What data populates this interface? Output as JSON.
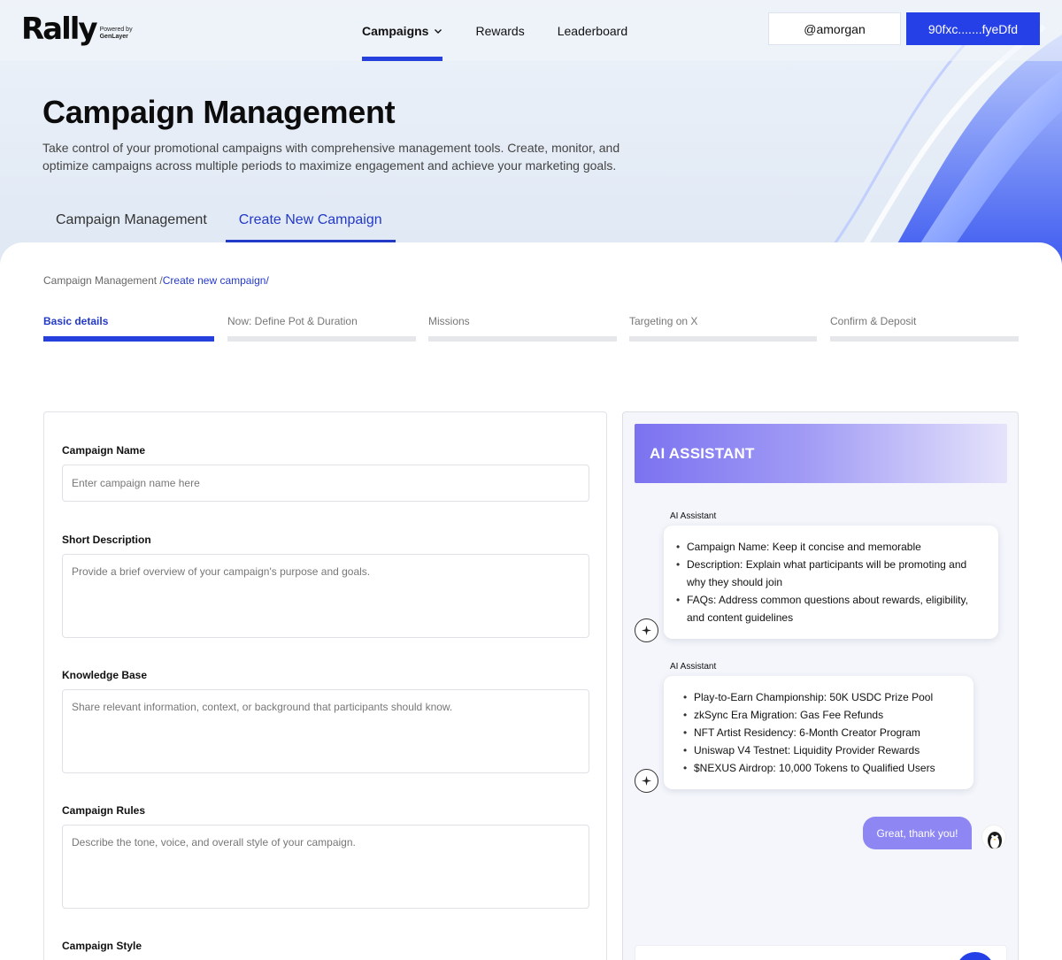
{
  "brand": {
    "logo_text": "Rally",
    "powered_by": "Powered by",
    "powered_name": "GenLayer"
  },
  "nav": {
    "links": [
      {
        "label": "Campaigns",
        "active": true
      },
      {
        "label": "Rewards",
        "active": false
      },
      {
        "label": "Leaderboard",
        "active": false
      }
    ],
    "user_handle": "@amorgan",
    "wallet": "90fxc.......fyeDfd"
  },
  "hero": {
    "title": "Campaign Management",
    "description": "Take control of your promotional campaigns with comprehensive management tools. Create, monitor, and optimize campaigns across multiple periods to maximize engagement and achieve your marketing goals.",
    "tabs": [
      {
        "label": "Campaign Management",
        "active": false
      },
      {
        "label": "Create New Campaign",
        "active": true
      }
    ]
  },
  "breadcrumb": {
    "root": "Campaign Management /",
    "current": "Create new campaign/"
  },
  "steps": [
    {
      "label": "Basic details",
      "active": true
    },
    {
      "label": "Now: Define Pot & Duration",
      "active": false
    },
    {
      "label": "Missions",
      "active": false
    },
    {
      "label": "Targeting on X",
      "active": false
    },
    {
      "label": "Confirm & Deposit",
      "active": false
    }
  ],
  "form": {
    "name": {
      "label": "Campaign Name",
      "placeholder": "Enter campaign name here",
      "value": ""
    },
    "description": {
      "label": "Short Description",
      "placeholder": "Provide a brief overview of your campaign's purpose and goals.",
      "value": ""
    },
    "knowledge": {
      "label": "Knowledge Base",
      "placeholder": "Share relevant information, context, or background that participants should know.",
      "value": ""
    },
    "rules": {
      "label": "Campaign Rules",
      "placeholder": "Describe the tone, voice, and overall style of your campaign.",
      "value": ""
    },
    "style": {
      "label": "Campaign Style"
    }
  },
  "assistant": {
    "title": "AI ASSISTANT",
    "messages": [
      {
        "sender": "AI Assistant",
        "items": [
          "Campaign Name: Keep it concise and memorable",
          "Description: Explain what participants will be promoting and why they should join",
          "FAQs: Address common questions about rewards, eligibility, and content guidelines"
        ]
      },
      {
        "sender": "AI Assistant",
        "items": [
          "Play-to-Earn Championship: 50K USDC Prize Pool",
          "zkSync Era Migration: Gas Fee Refunds",
          "NFT Artist Residency: 6-Month Creator Program",
          "Uniswap V4 Testnet: Liquidity Provider Rewards",
          "$NEXUS Airdrop: 10,000 Tokens to Qualified Users"
        ]
      }
    ],
    "user_reply": "Great, thank you!",
    "bot_icon": "sparkle-icon",
    "avatar_icon": "penguin-avatar-icon"
  },
  "colors": {
    "accent": "#2540e6",
    "accent_text": "#2339c8",
    "assistant_gradient_start": "#7b72f0",
    "user_bubble": "#8e86f2"
  }
}
